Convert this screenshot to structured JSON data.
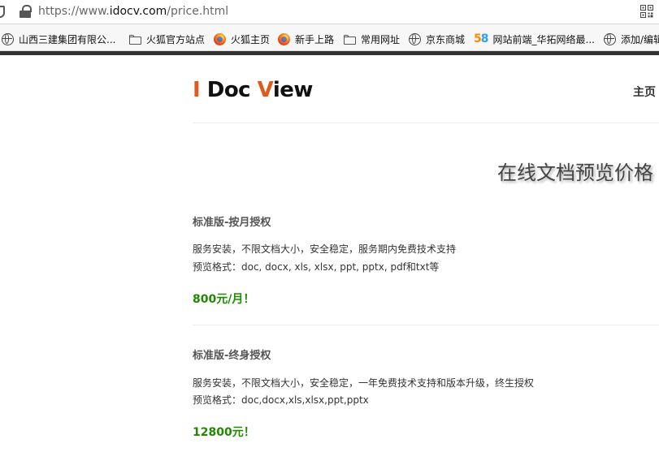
{
  "browser": {
    "url_scheme": "https://www.",
    "url_host": "idocv.com",
    "url_path": "/price.html",
    "bookmarks": [
      {
        "label": "山西三建集团有限公...",
        "icon": "globe-icon"
      },
      {
        "label": "火狐官方站点",
        "icon": "folder-icon"
      },
      {
        "label": "火狐主页",
        "icon": "firefox-icon"
      },
      {
        "label": "新手上路",
        "icon": "firefox-icon"
      },
      {
        "label": "常用网址",
        "icon": "folder-icon"
      },
      {
        "label": "京东商城",
        "icon": "globe-icon"
      },
      {
        "label": "网站前端_华拓网络最...",
        "icon": "58-icon"
      },
      {
        "label": "添加/编辑",
        "icon": "globe-icon"
      }
    ]
  },
  "site": {
    "logo_parts": [
      "I",
      " Doc ",
      "V",
      "iew"
    ],
    "nav_home": "主页"
  },
  "page": {
    "title": "在线文档预览价格",
    "plans": [
      {
        "name": "标准版-按月授权",
        "desc": "服务安装，不限文档大小，安全稳定，服务期内免费技术支持",
        "formats": "预览格式：doc, docx, xls, xlsx, ppt, pptx, pdf和txt等",
        "price": "800元/月！"
      },
      {
        "name": "标准版-终身授权",
        "desc": "服务安装，不限文档大小，安全稳定，一年免费技术支持和版本升级，终生授权",
        "formats": "预览格式：doc,docx,xls,xlsx,ppt,pptx",
        "price": "12800元！"
      }
    ]
  },
  "colors": {
    "logo_accent": "#e05a1e",
    "price_green": "#1f8a00",
    "toolbar_dark": "#333333"
  }
}
